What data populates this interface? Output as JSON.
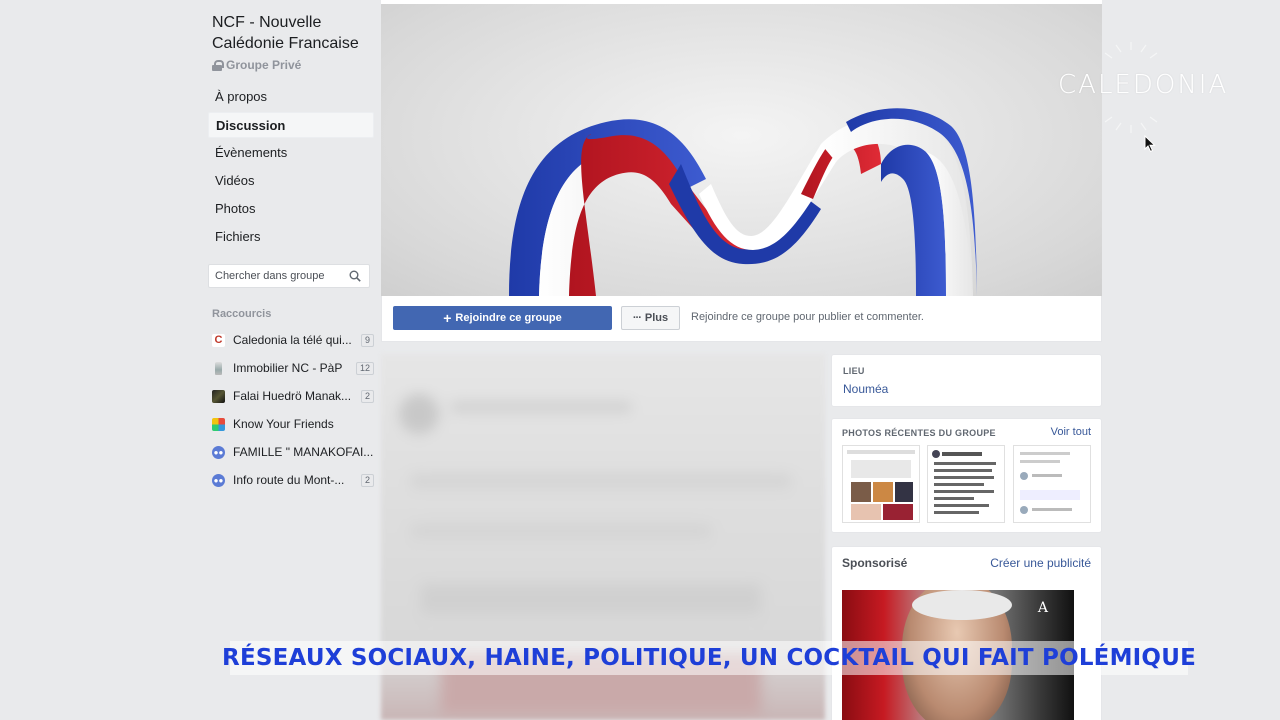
{
  "group": {
    "title": "NCF - Nouvelle Calédonie Francaise",
    "privacy": "Groupe Privé"
  },
  "nav": [
    {
      "label": "À propos",
      "active": false
    },
    {
      "label": "Discussion",
      "active": true
    },
    {
      "label": "Évènements",
      "active": false
    },
    {
      "label": "Vidéos",
      "active": false
    },
    {
      "label": "Photos",
      "active": false
    },
    {
      "label": "Fichiers",
      "active": false
    }
  ],
  "search": {
    "placeholder": "Chercher dans groupe"
  },
  "shortcuts": {
    "title": "Raccourcis",
    "items": [
      {
        "label": "Caledonia la télé qui...",
        "badge": "9",
        "icon": "caledonia-logo-icon"
      },
      {
        "label": "Immobilier NC - PàP",
        "badge": "12",
        "icon": "bottle-icon"
      },
      {
        "label": "Falai Huedrö Manak...",
        "badge": "2",
        "icon": "photo-icon"
      },
      {
        "label": "Know Your Friends",
        "badge": "",
        "icon": "app-icon"
      },
      {
        "label": "FAMILLE \" MANAKOFAI...",
        "badge": "",
        "icon": "group-icon"
      },
      {
        "label": "Info route du Mont-...",
        "badge": "2",
        "icon": "group-icon"
      }
    ]
  },
  "actions": {
    "join": "Rejoindre ce groupe",
    "more": "Plus",
    "hint": "Rejoindre ce groupe pour publier et commenter."
  },
  "location": {
    "label": "LIEU",
    "value": "Nouméa"
  },
  "recent_photos": {
    "title": "PHOTOS RÉCENTES DU GROUPE",
    "link": "Voir tout"
  },
  "sponsored": {
    "title": "Sponsorisé",
    "link": "Créer une publicité"
  },
  "overlay": {
    "brand": "CALEDONIA",
    "headline": "RÉSEAUX SOCIAUX, HAINE, POLITIQUE, UN COCKTAIL QUI FAIT POLÉMIQUE"
  },
  "colors": {
    "fb_blue": "#4267b2",
    "link": "#385898",
    "headline": "#1e3fd8",
    "ribbon_blue": "#2b45b8",
    "ribbon_red": "#d11f2c"
  }
}
